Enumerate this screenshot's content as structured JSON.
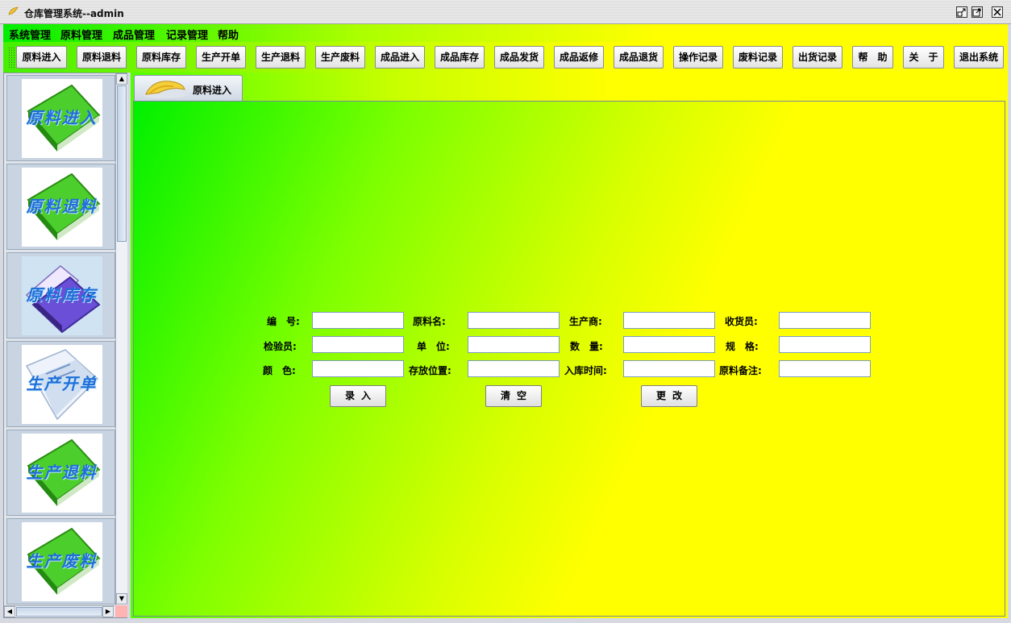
{
  "window": {
    "title": "仓库管理系统--admin"
  },
  "menu": [
    "系统管理",
    "原料管理",
    "成品管理",
    "记录管理",
    "帮助"
  ],
  "toolbar": [
    "原料进入",
    "原料退料",
    "原料库存",
    "生产开单",
    "生产退料",
    "生产废料",
    "成品进入",
    "成品库存",
    "成品发货",
    "成品返修",
    "成品退货",
    "操作记录",
    "废料记录",
    "出货记录",
    "帮　助",
    "关　于",
    "退出系统"
  ],
  "sidebar": [
    "原料进入",
    "原料退料",
    "原料库存",
    "生产开单",
    "生产退料",
    "生产废料"
  ],
  "tab": {
    "label": "原料进入"
  },
  "form": {
    "labels": [
      "编　号:",
      "原料名:",
      "生产商:",
      "收货员:",
      "检验员:",
      "单　位:",
      "数　量:",
      "规　格:",
      "颜　色:",
      "存放位置:",
      "入库时间:",
      "原料备注:"
    ],
    "values": [
      "",
      "",
      "",
      "",
      "",
      "",
      "",
      "",
      "",
      "",
      "",
      ""
    ],
    "buttons": [
      "录入",
      "清空",
      "更改"
    ]
  },
  "colors": {
    "accent_green": "#00ee00",
    "accent_yellow": "#ffff00",
    "input_border": "#7f9db9"
  }
}
